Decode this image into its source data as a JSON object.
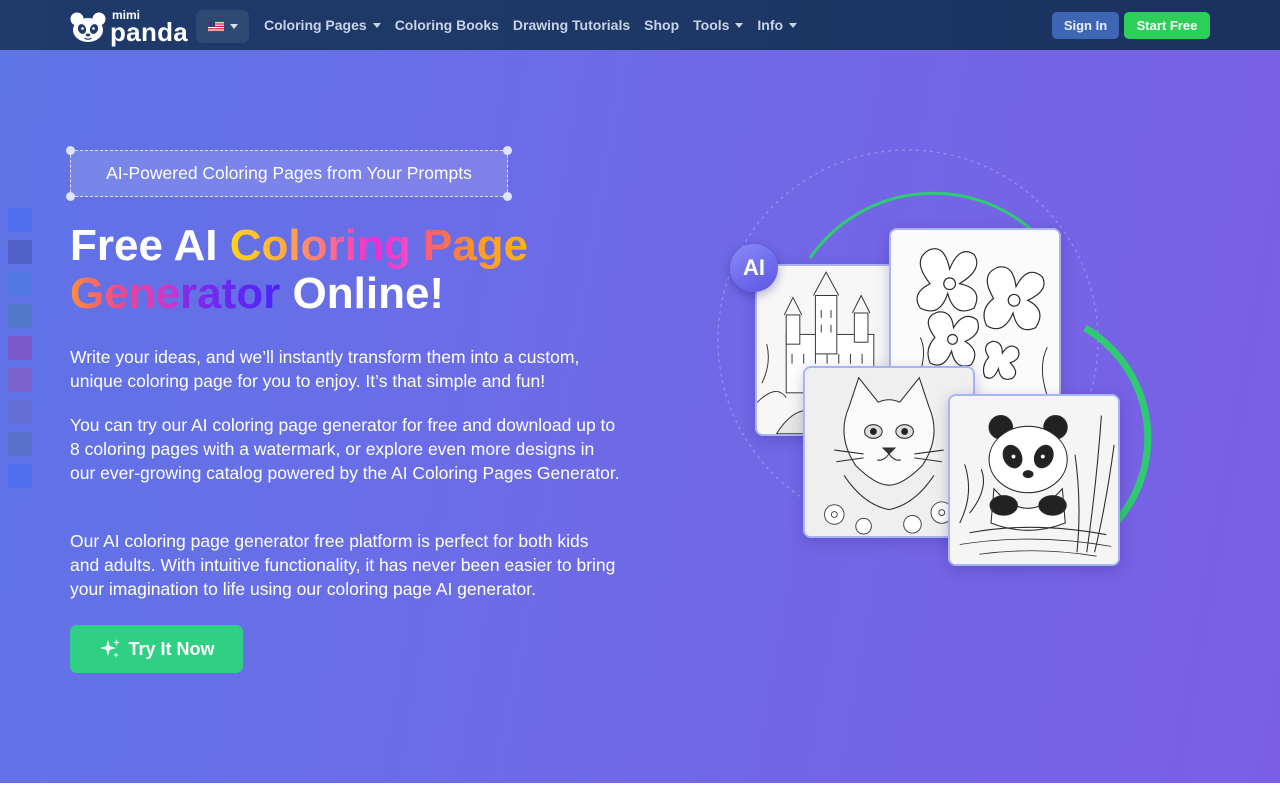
{
  "nav": {
    "logo_small": "mimi",
    "logo_big": "panda",
    "language_flag": "us-flag-icon",
    "links": [
      {
        "label": "Coloring Pages",
        "dropdown": true
      },
      {
        "label": "Coloring Books",
        "dropdown": false
      },
      {
        "label": "Drawing Tutorials",
        "dropdown": false
      },
      {
        "label": "Shop",
        "dropdown": false
      },
      {
        "label": "Tools",
        "dropdown": true
      },
      {
        "label": "Info",
        "dropdown": true
      }
    ],
    "sign_in": "Sign In",
    "start_free": "Start Free"
  },
  "hero": {
    "tagline": "AI-Powered Coloring Pages from Your Prompts",
    "title": {
      "part1": "Free AI ",
      "highlight_a": "Coloring",
      "highlight_b": " Page",
      "highlight_c": "Gene",
      "highlight_d": "rator",
      "part2": " Online!"
    },
    "paragraphs": [
      "Write your ideas, and we’ll instantly transform them into a custom, unique coloring page for you to enjoy. It’s that simple and fun!",
      "You can try our AI coloring page generator for free and download up to 8 coloring pages with a watermark, or explore even more designs in our ever-growing catalog powered by the AI Coloring Pages Generator.",
      "Our AI coloring page generator free platform is perfect for both kids and adults. With intuitive functionality, it has never been easier to bring your imagination to life using our coloring page AI generator."
    ],
    "cta": "Try It Now",
    "ai_badge": "AI"
  },
  "side_swatches": [
    "#4f6ff0",
    "#5060c6",
    "#5278e4",
    "#4f78c7",
    "#7a59c9",
    "#7b63cd",
    "#6570d4",
    "#5a6fc8",
    "#4e6ef0"
  ],
  "colors": {
    "nav_bg": "#1f3a6b",
    "sign_in_bg": "#3d67b4",
    "start_free_bg": "#2ccf5a",
    "cta_bg": "#2fd083",
    "ring_green": "#2ecc71"
  },
  "images": [
    "castle-coloring-page",
    "orchid-coloring-page",
    "cat-coloring-page",
    "panda-coloring-page"
  ]
}
